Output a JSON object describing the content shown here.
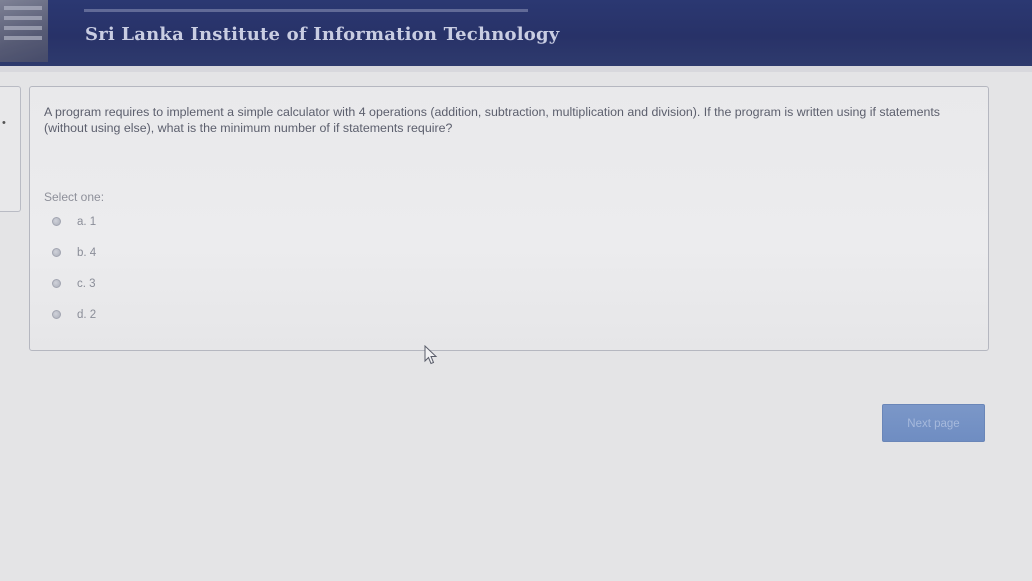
{
  "header": {
    "title": "Sri Lanka Institute of Information Technology"
  },
  "question": {
    "text": "A program requires to implement a simple calculator with 4 operations (addition, subtraction, multiplication and division). If the program is written using if statements (without using else), what is the minimum number of if statements require?",
    "select_label": "Select one:",
    "options": [
      {
        "label": "a. 1"
      },
      {
        "label": "b. 4"
      },
      {
        "label": "c. 3"
      },
      {
        "label": "d. 2"
      }
    ]
  },
  "navigation": {
    "next_label": "Next page"
  },
  "icons": {
    "logo": "institution-logo-icon",
    "cursor": "mouse-pointer-icon",
    "radio": "radio-button-icon"
  },
  "colors": {
    "header_bg": "#283268",
    "button_bg": "#7391c4",
    "card_bg": "#ebebed"
  }
}
